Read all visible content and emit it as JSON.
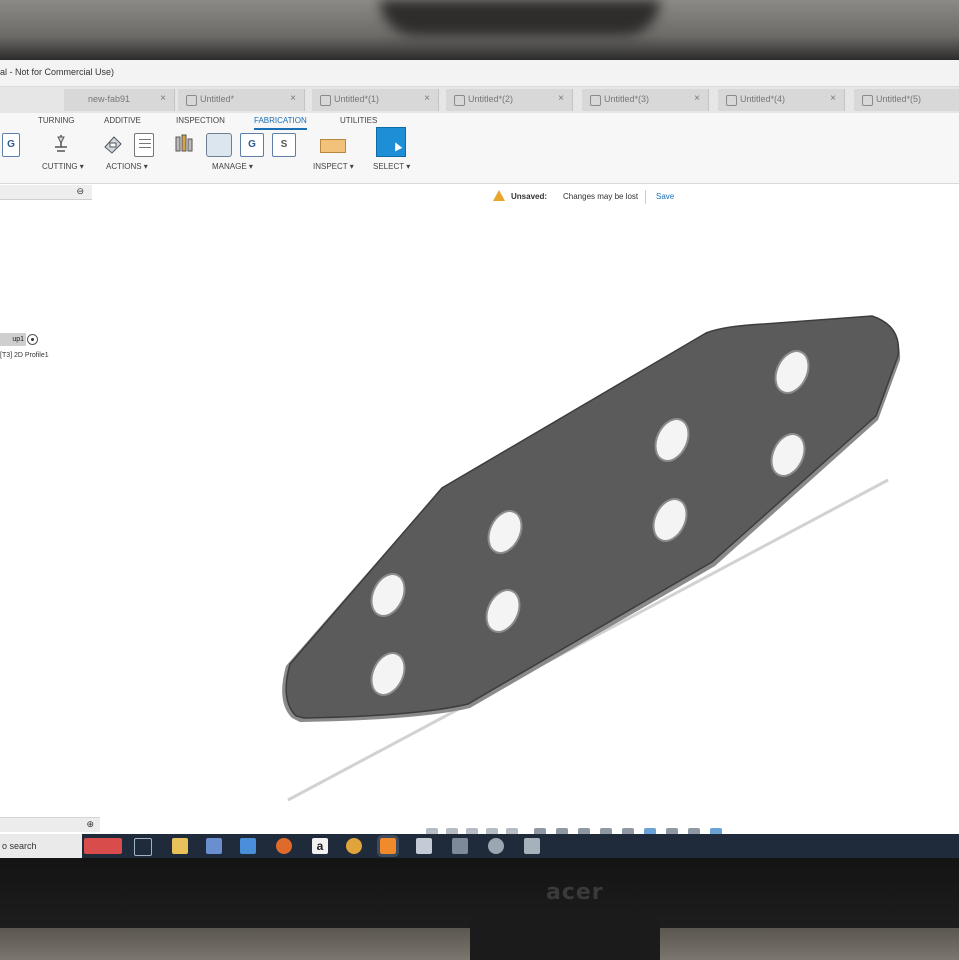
{
  "window": {
    "title": "al - Not for Commercial Use)"
  },
  "tabs": [
    {
      "label": "new-fab91",
      "active": false
    },
    {
      "label": "Untitled*",
      "active": false
    },
    {
      "label": "Untitled*(1)",
      "active": false
    },
    {
      "label": "Untitled*(2)",
      "active": false
    },
    {
      "label": "Untitled*(3)",
      "active": false
    },
    {
      "label": "Untitled*(4)",
      "active": false
    },
    {
      "label": "Untitled*(5)",
      "active": false
    }
  ],
  "ribbon": {
    "tabs": [
      "TURNING",
      "ADDITIVE",
      "INSPECTION",
      "FABRICATION",
      "UTILITIES"
    ],
    "active_tab": "FABRICATION",
    "groups": [
      "CUTTING ▾",
      "ACTIONS ▾",
      "MANAGE ▾",
      "INSPECT ▾",
      "SELECT ▾"
    ],
    "icon_letters": {
      "g": "G",
      "s": "S"
    }
  },
  "warning": {
    "label": "Unsaved:",
    "message": "Changes may be lost",
    "save": "Save",
    "color": "#e8a52b"
  },
  "browser": {
    "node_label": "up1",
    "item_label": "[T3] 2D Profile1",
    "collapse_symbol": "⊖",
    "expand_symbol": "⊕"
  },
  "taskbar": {
    "search_text": "o search",
    "app_letter": "a"
  },
  "monitor": {
    "brand": "acer"
  },
  "colors": {
    "accent": "#1a6fb5",
    "part_face": "#5b5b5b",
    "select_button": "#1e8fd6"
  }
}
